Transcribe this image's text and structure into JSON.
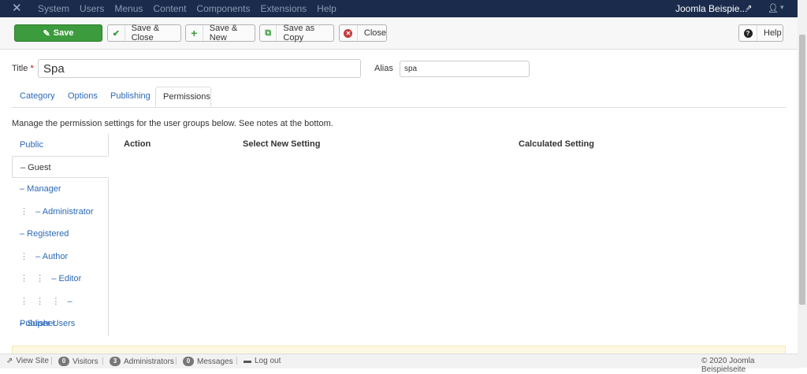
{
  "topnav": {
    "menu": [
      "System",
      "Users",
      "Menus",
      "Content",
      "Components",
      "Extensions",
      "Help"
    ],
    "site_name": "Joomla Beispie...",
    "colors": {
      "bar": "#1a2b4c"
    }
  },
  "toolbar": {
    "save": "Save",
    "save_close": "Save & Close",
    "save_new": "Save & New",
    "save_copy": "Save as Copy",
    "close": "Close",
    "help": "Help"
  },
  "form": {
    "title_label": "Title",
    "title_required": "*",
    "title_value": "Spa",
    "alias_label": "Alias",
    "alias_value": "spa"
  },
  "tabs": [
    "Category",
    "Options",
    "Publishing",
    "Permissions"
  ],
  "active_tab": "Permissions",
  "permissions": {
    "description": "Manage the permission settings for the user groups below. See notes at the bottom.",
    "groups": [
      {
        "label": "Public",
        "dots": ""
      },
      {
        "label": "– Guest",
        "dots": ""
      },
      {
        "label": "– Manager",
        "dots": ""
      },
      {
        "label": "– Administrator",
        "dots": "⋮"
      },
      {
        "label": "– Registered",
        "dots": ""
      },
      {
        "label": "– Author",
        "dots": "⋮"
      },
      {
        "label": "– Editor",
        "dots": "⋮   ⋮"
      },
      {
        "label": "– Publisher",
        "dots": "⋮   ⋮   ⋮"
      },
      {
        "label": "– Super Users",
        "dots": ""
      }
    ],
    "columns": {
      "action": "Action",
      "select_new": "Select New Setting",
      "calculated": "Calculated Setting"
    }
  },
  "statusbar": {
    "view_site": "View Site",
    "visitors_count": "0",
    "visitors": "Visitors",
    "admins_count": "3",
    "admins": "Administrators",
    "messages_count": "0",
    "messages": "Messages",
    "logout": "Log out",
    "copyright": "© 2020 Joomla Beispielseite"
  }
}
